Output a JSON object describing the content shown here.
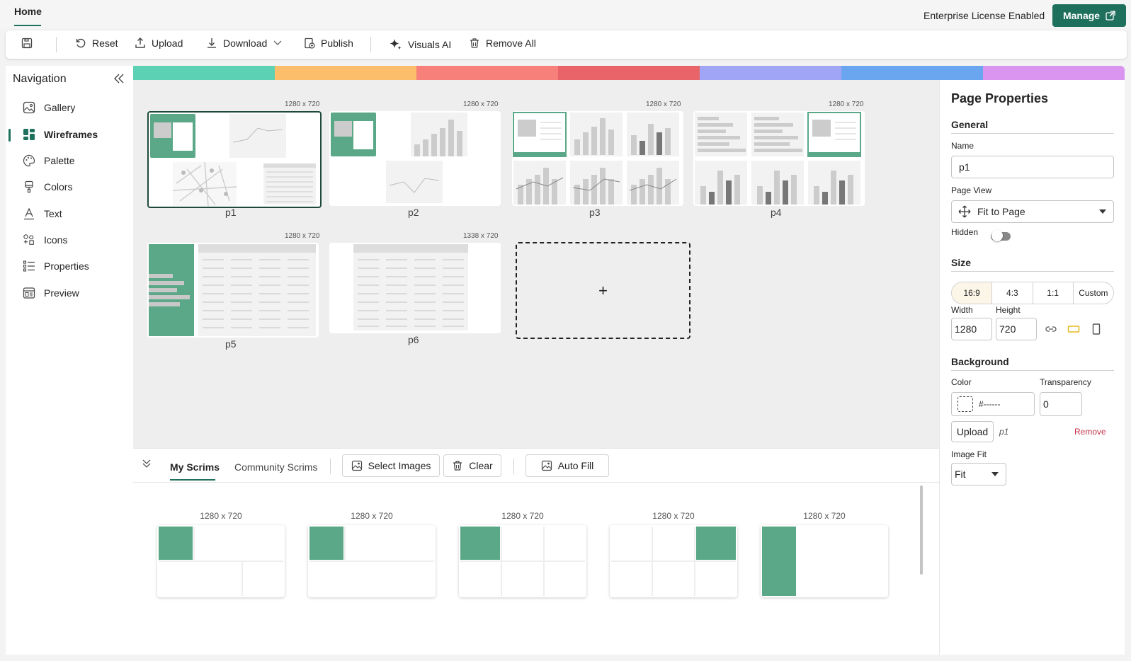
{
  "header": {
    "home_tab": "Home",
    "license_text": "Enterprise License Enabled",
    "manage_label": "Manage"
  },
  "toolbar": {
    "reset": "Reset",
    "upload": "Upload",
    "download": "Download",
    "publish": "Publish",
    "visuals_ai": "Visuals AI",
    "remove_all": "Remove All"
  },
  "nav": {
    "title": "Navigation",
    "items": [
      {
        "label": "Gallery",
        "icon": "gallery-icon"
      },
      {
        "label": "Wireframes",
        "icon": "wireframes-icon",
        "active": true
      },
      {
        "label": "Palette",
        "icon": "palette-icon"
      },
      {
        "label": "Colors",
        "icon": "colors-icon"
      },
      {
        "label": "Text",
        "icon": "text-icon"
      },
      {
        "label": "Icons",
        "icon": "icons-icon"
      },
      {
        "label": "Properties",
        "icon": "properties-icon"
      },
      {
        "label": "Preview",
        "icon": "preview-icon"
      }
    ]
  },
  "palette_colors": [
    "#5cd1b4",
    "#fdbe6b",
    "#f8807a",
    "#e96468",
    "#a0a5f5",
    "#6aa5ef",
    "#d995f0"
  ],
  "pages": [
    {
      "name": "p1",
      "size": "1280 x 720",
      "selected": true
    },
    {
      "name": "p2",
      "size": "1280 x 720"
    },
    {
      "name": "p3",
      "size": "1280 x 720"
    },
    {
      "name": "p4",
      "size": "1280 x 720"
    },
    {
      "name": "p5",
      "size": "1280 x 720"
    },
    {
      "name": "p6",
      "size": "1338 x 720"
    }
  ],
  "add_page_symbol": "+",
  "scrims": {
    "tabs": [
      "My Scrims",
      "Community Scrims"
    ],
    "select_images": "Select Images",
    "clear": "Clear",
    "auto_fill": "Auto Fill",
    "items": [
      {
        "size": "1280 x 720"
      },
      {
        "size": "1280 x 720"
      },
      {
        "size": "1280 x 720"
      },
      {
        "size": "1280 x 720"
      },
      {
        "size": "1280 x 720"
      }
    ]
  },
  "props": {
    "title": "Page Properties",
    "general": "General",
    "name_label": "Name",
    "name_value": "p1",
    "page_view_label": "Page View",
    "page_view_value": "Fit to Page",
    "hidden_label": "Hidden",
    "hidden_on": false,
    "size": "Size",
    "ratios": [
      "16:9",
      "4:3",
      "1:1",
      "Custom"
    ],
    "selected_ratio": "16:9",
    "width_label": "Width",
    "width_value": "1280",
    "height_label": "Height",
    "height_value": "720",
    "background": "Background",
    "color_label": "Color",
    "color_value": "#------",
    "transparency_label": "Transparency",
    "transparency_value": "0",
    "upload": "Upload",
    "image_name": "p1",
    "remove": "Remove",
    "image_fit_label": "Image Fit",
    "image_fit_value": "Fit"
  },
  "colors": {
    "accent": "#1e6f5c",
    "wire_green": "#5aa888",
    "remove_red": "#c4314b"
  }
}
